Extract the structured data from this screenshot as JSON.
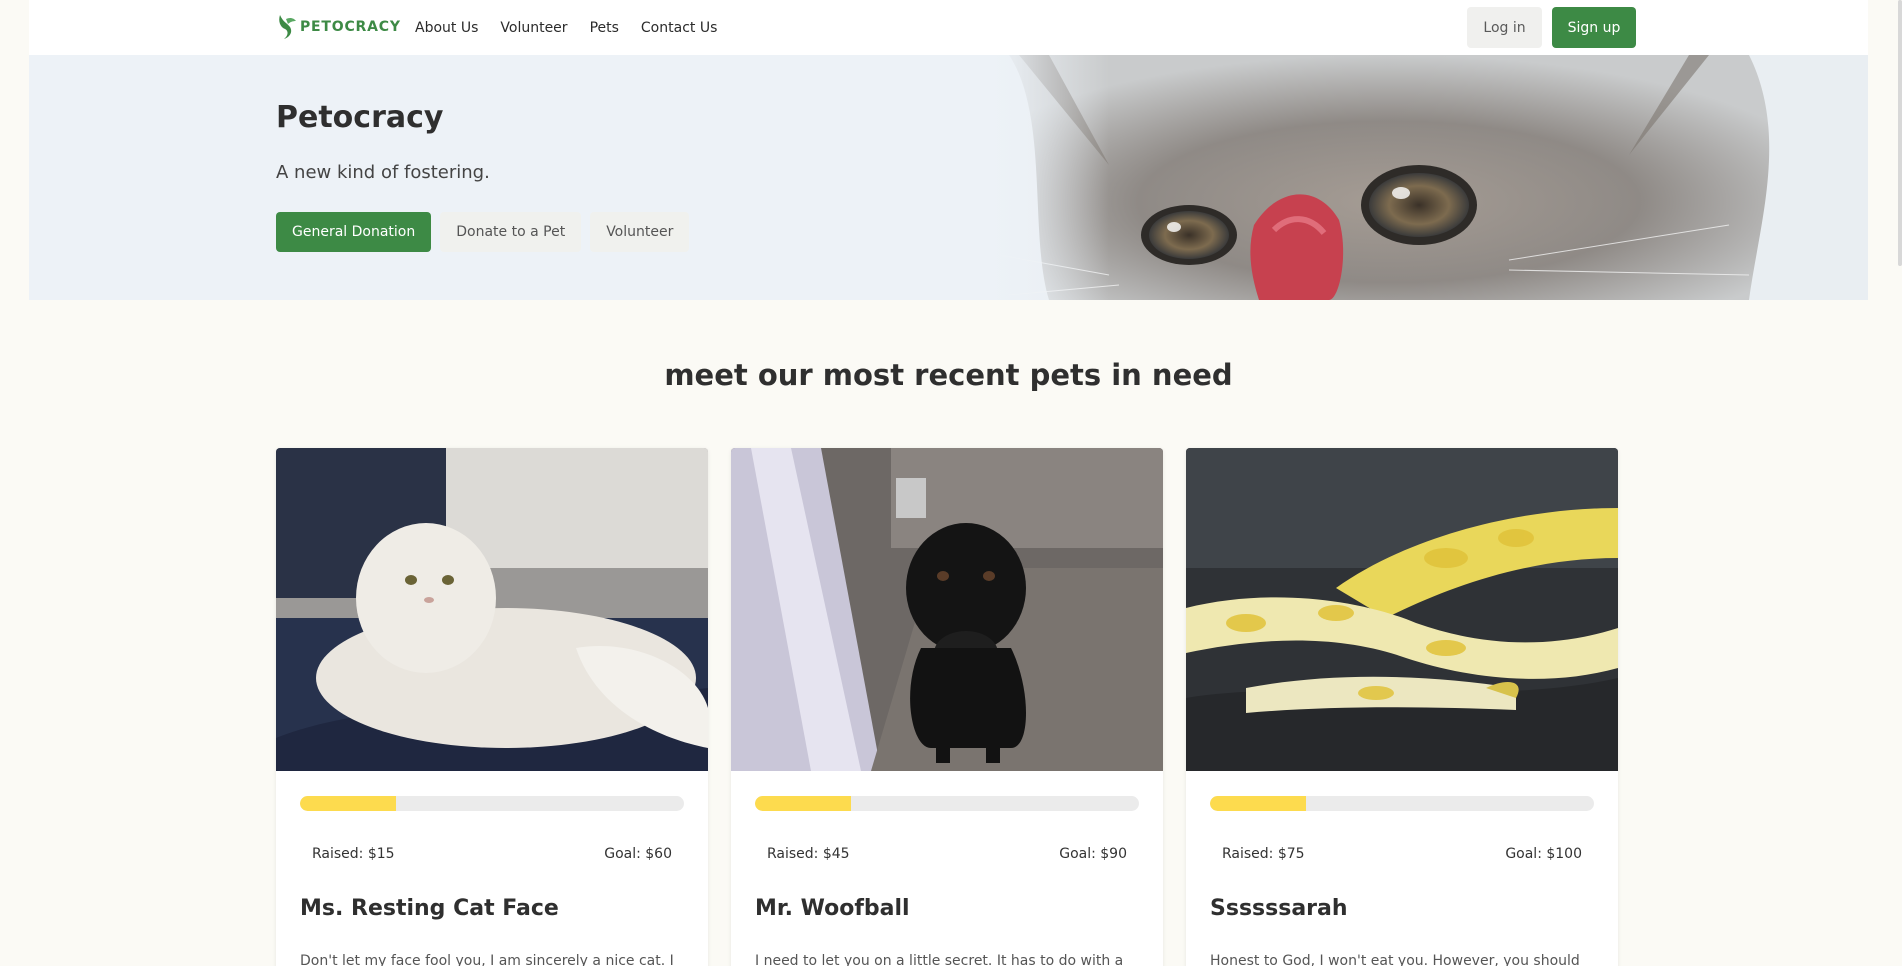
{
  "navbar": {
    "brand": "PETOCRACY",
    "links": [
      "About Us",
      "Volunteer",
      "Pets",
      "Contact Us"
    ],
    "login_label": "Log in",
    "signup_label": "Sign up"
  },
  "hero": {
    "title": "Petocracy",
    "subtitle": "A new kind of fostering.",
    "buttons": {
      "general_donation": "General Donation",
      "donate_to_pet": "Donate to a Pet",
      "volunteer": "Volunteer"
    },
    "image": "kitten-licking-nose-photo"
  },
  "section": {
    "heading": "meet our most recent pets in need"
  },
  "pets": [
    {
      "name": "Ms. Resting Cat Face",
      "raised": "Raised: $15",
      "goal": "Goal: $60",
      "progress": 0.25,
      "description": "Don't let my face fool you, I am sincerely a nice cat. I love",
      "image": "white-persian-cat-photo"
    },
    {
      "name": "Mr. Woofball",
      "raised": "Raised: $45",
      "goal": "Goal: $90",
      "progress": 0.25,
      "description": "I need to let you on a little secret. It has to do with a ball",
      "image": "black-labrador-photo"
    },
    {
      "name": "Ssssssarah",
      "raised": "Raised: $75",
      "goal": "Goal: $100",
      "progress": 0.25,
      "description": "Honest to God, I won't eat you. However, you should",
      "image": "yellow-python-photo"
    }
  ],
  "colors": {
    "brand_green": "#3d8a45",
    "progress_yellow": "#fddb4e",
    "page_background": "#fbfaf5",
    "hero_background": "#edf2f7"
  }
}
